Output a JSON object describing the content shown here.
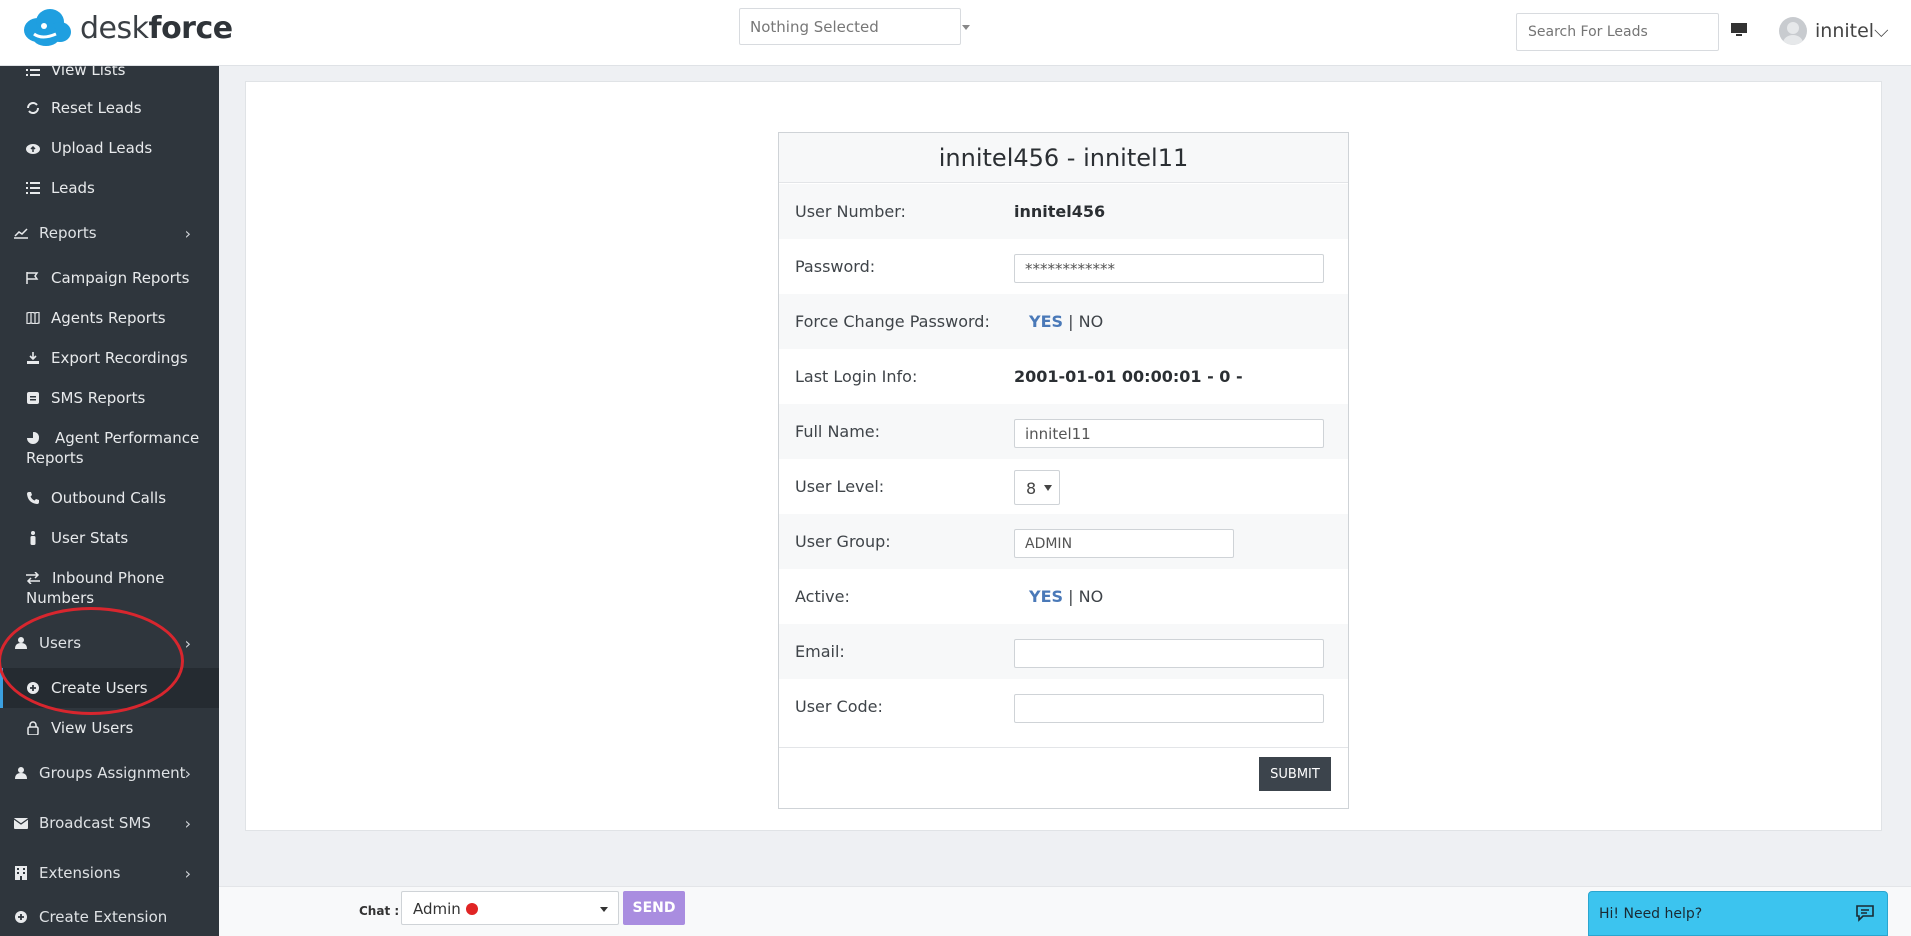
{
  "header": {
    "brand_prefix": "desk",
    "brand_suffix": "force",
    "selector_text": "Nothing Selected",
    "search_placeholder": "Search For Leads",
    "username": "innitel",
    "username_caret": "⌵"
  },
  "sidebar": {
    "items": [
      {
        "label": "View Lists",
        "icon": "list-icon"
      },
      {
        "label": "Reset Leads",
        "icon": "reset-icon"
      },
      {
        "label": "Upload Leads",
        "icon": "cloud-upload-icon"
      },
      {
        "label": "Leads",
        "icon": "list-icon"
      },
      {
        "label": "Reports",
        "icon": "chart-icon"
      },
      {
        "label": "Campaign Reports",
        "icon": "flag-icon"
      },
      {
        "label": "Agents Reports",
        "icon": "map-icon"
      },
      {
        "label": "Export Recordings",
        "icon": "download-icon"
      },
      {
        "label": "SMS Reports",
        "icon": "message-icon"
      },
      {
        "label": "Agent Performance",
        "label2": "Reports",
        "icon": "pie-chart-icon"
      },
      {
        "label": "Outbound Calls",
        "icon": "phone-icon"
      },
      {
        "label": "User Stats",
        "icon": "person-icon"
      },
      {
        "label": "Inbound Phone",
        "label2": "Numbers",
        "icon": "exchange-icon"
      },
      {
        "label": "Users",
        "icon": "user-icon"
      },
      {
        "label": "Create Users",
        "icon": "plus-circle-icon"
      },
      {
        "label": "View Users",
        "icon": "lock-icon"
      },
      {
        "label": "Groups Assignment",
        "icon": "user-icon"
      },
      {
        "label": "Broadcast SMS",
        "icon": "envelope-icon"
      },
      {
        "label": "Extensions",
        "icon": "building-icon"
      },
      {
        "label": "Create Extension",
        "icon": "plus-circle-icon"
      }
    ]
  },
  "form": {
    "title": "innitel456 - innitel11",
    "user_number_label": "User Number:",
    "user_number_value": "innitel456",
    "password_label": "Password:",
    "password_value": "************",
    "force_change_label": "Force Change Password:",
    "yes": "YES",
    "separator": " | ",
    "no": "NO",
    "last_login_label": "Last Login Info:",
    "last_login_value": "2001-01-01 00:00:01 - 0 -",
    "full_name_label": "Full Name:",
    "full_name_value": "innitel11",
    "user_level_label": "User Level:",
    "user_level_value": "8",
    "user_group_label": "User Group:",
    "user_group_value": "ADMIN",
    "active_label": "Active:",
    "email_label": "Email:",
    "email_value": "",
    "user_code_label": "User Code:",
    "user_code_value": "",
    "submit_label": "SUBMIT"
  },
  "footer": {
    "chat_label": "Chat :",
    "chat_recipient": "Admin",
    "send_label": "SEND",
    "help_text": "Hi! Need help?"
  },
  "colors": {
    "sidebar_bg": "#2f363d",
    "accent_blue": "#4a79b8",
    "send_purple": "#a98de0",
    "help_cyan": "#3cc4ef",
    "annotation_red": "#d8262e"
  }
}
